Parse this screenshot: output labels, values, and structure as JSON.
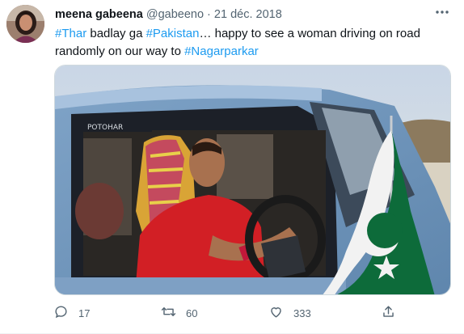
{
  "tweet": {
    "author_name": "meena gabeena",
    "handle": "@gabeeno",
    "separator": "·",
    "date": "21 déc. 2018",
    "text_parts": {
      "p1": "#Thar",
      "p2": " badlay ga ",
      "p3": "#Pakistan",
      "p4": "… happy to see a woman driving on road randomly on our way to ",
      "p5": "#Nagarparkar"
    },
    "media": {
      "car_badge": "POTOHAR"
    },
    "actions": {
      "replies": "17",
      "retweets": "60",
      "likes": "333"
    }
  },
  "icons": {
    "more": "more-horizontal-icon",
    "reply": "reply-icon",
    "retweet": "retweet-icon",
    "like": "heart-icon",
    "share": "share-icon"
  },
  "colors": {
    "link": "#1d9bf0",
    "secondary_text": "#536471",
    "primary_text": "#0f1419"
  }
}
